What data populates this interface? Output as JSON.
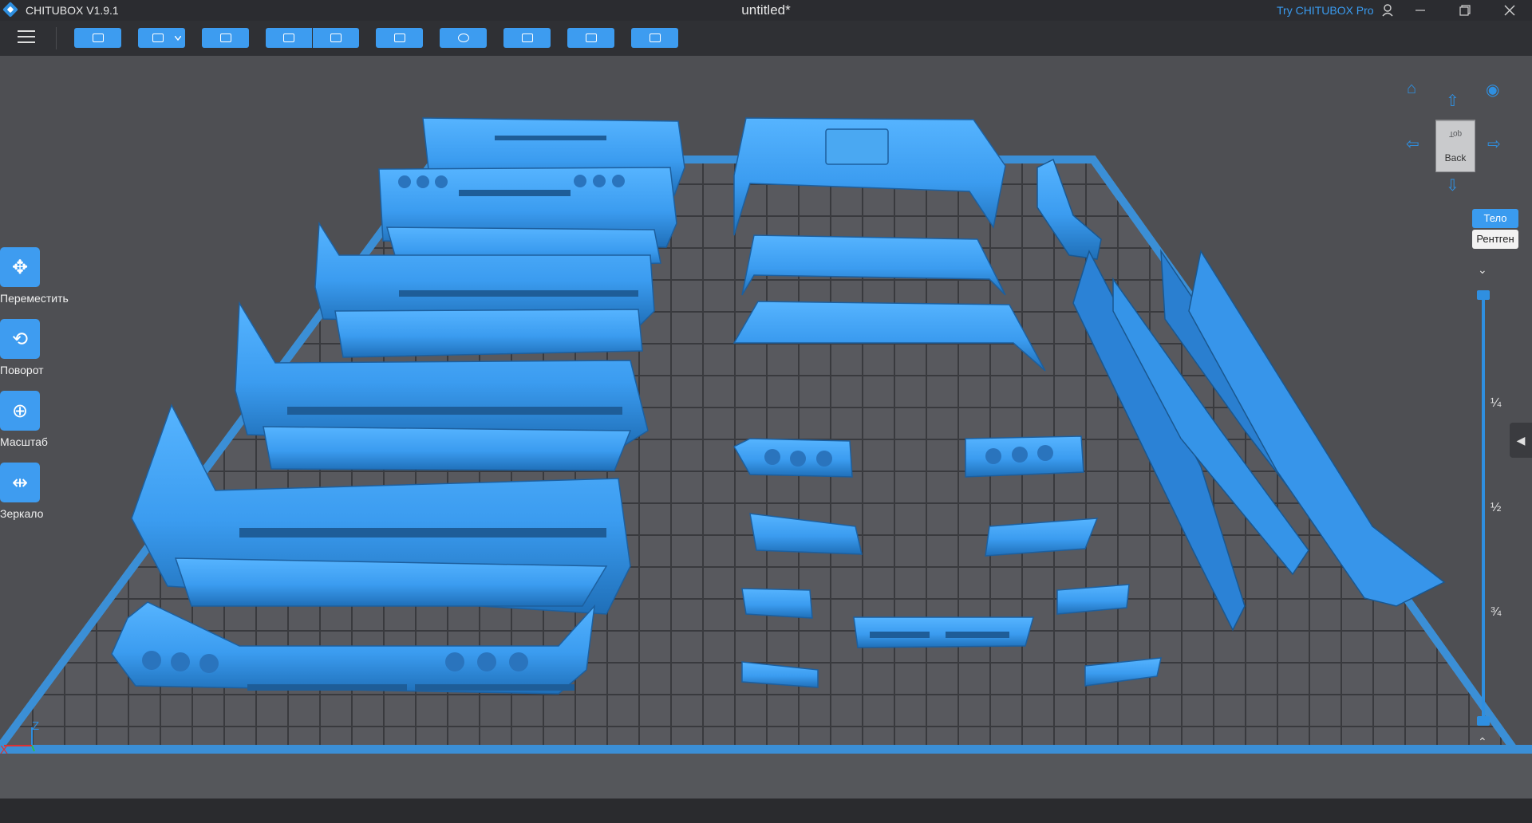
{
  "app": {
    "name": "CHITUBOX V1.9.1",
    "document": "untitled*",
    "try_pro": "Try CHITUBOX Pro"
  },
  "window": {
    "minimize_icon": "minimize-icon",
    "restore_icon": "restore-icon",
    "close_icon": "close-icon"
  },
  "toolbar": {
    "items": [
      {
        "name": "open-file-button",
        "icon": "folder-icon"
      },
      {
        "name": "save-button",
        "icon": "save-icon"
      },
      {
        "name": "screenshot-button",
        "icon": "frame-icon"
      },
      {
        "name": "undo-button",
        "icon": "undo-icon"
      },
      {
        "name": "redo-button",
        "icon": "redo-icon"
      },
      {
        "name": "settings-button",
        "icon": "list-icon"
      },
      {
        "name": "arrange-button",
        "icon": "arrange-icon"
      },
      {
        "name": "supports-button",
        "icon": "support-icon"
      },
      {
        "name": "hollow-button",
        "icon": "hollow-icon"
      },
      {
        "name": "slice-button",
        "icon": "slice-icon"
      }
    ]
  },
  "left_tools": [
    {
      "label": "Переместить",
      "icon": "move-icon"
    },
    {
      "label": "Поворот",
      "icon": "rotate-icon"
    },
    {
      "label": "Масштаб",
      "icon": "scale-icon"
    },
    {
      "label": "Зеркало",
      "icon": "mirror-icon"
    }
  ],
  "view_cube": {
    "top": "Top",
    "back": "Back"
  },
  "visibility": {
    "body": "Тело",
    "xray": "Рентген"
  },
  "layer_slider": {
    "fractions": [
      "¼",
      "½",
      "¾"
    ],
    "top_value": 1.0,
    "bottom_value": 0.0
  },
  "axes": {
    "x": "X",
    "y": "Y",
    "z": "Z"
  },
  "colors": {
    "accent": "#3d9cf0",
    "model": "#3b9cf0",
    "plate_border": "#3b8fd6"
  }
}
